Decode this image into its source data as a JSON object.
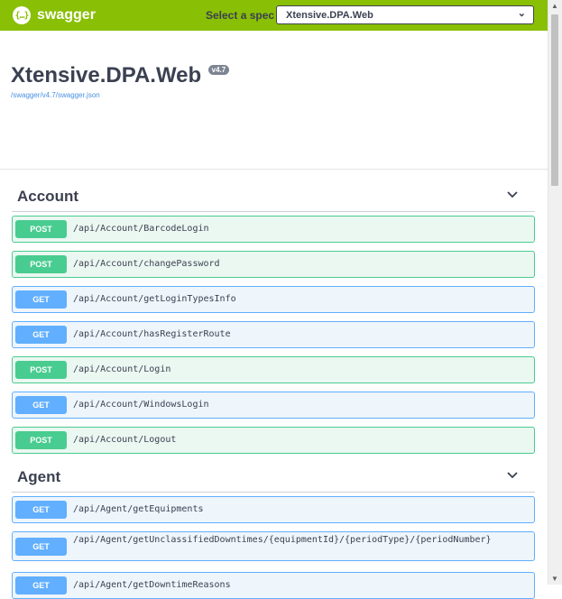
{
  "topbar": {
    "logo_icon": "{…}",
    "logo_text": "swagger",
    "spec_label": "Select a spec",
    "spec_value": "Xtensive.DPA.Web"
  },
  "info": {
    "title": "Xtensive.DPA.Web",
    "version": "v4.7",
    "spec_url": "/swagger/v4.7/swagger.json"
  },
  "sections": [
    {
      "name": "Account",
      "operations": [
        {
          "method": "POST",
          "path": "/api/Account/BarcodeLogin"
        },
        {
          "method": "POST",
          "path": "/api/Account/changePassword"
        },
        {
          "method": "GET",
          "path": "/api/Account/getLoginTypesInfo"
        },
        {
          "method": "GET",
          "path": "/api/Account/hasRegisterRoute"
        },
        {
          "method": "POST",
          "path": "/api/Account/Login"
        },
        {
          "method": "GET",
          "path": "/api/Account/WindowsLogin"
        },
        {
          "method": "POST",
          "path": "/api/Account/Logout"
        }
      ]
    },
    {
      "name": "Agent",
      "operations": [
        {
          "method": "GET",
          "path": "/api/Agent/getEquipments"
        },
        {
          "method": "GET",
          "path": "/api/Agent/getUnclassifiedDowntimes/{equipmentId}/{periodType}/{periodNumber}"
        },
        {
          "method": "GET",
          "path": "/api/Agent/getDowntimeReasons"
        }
      ]
    }
  ],
  "colors": {
    "brand": "#89bf04",
    "post": "#49cc90",
    "get": "#61affe"
  }
}
